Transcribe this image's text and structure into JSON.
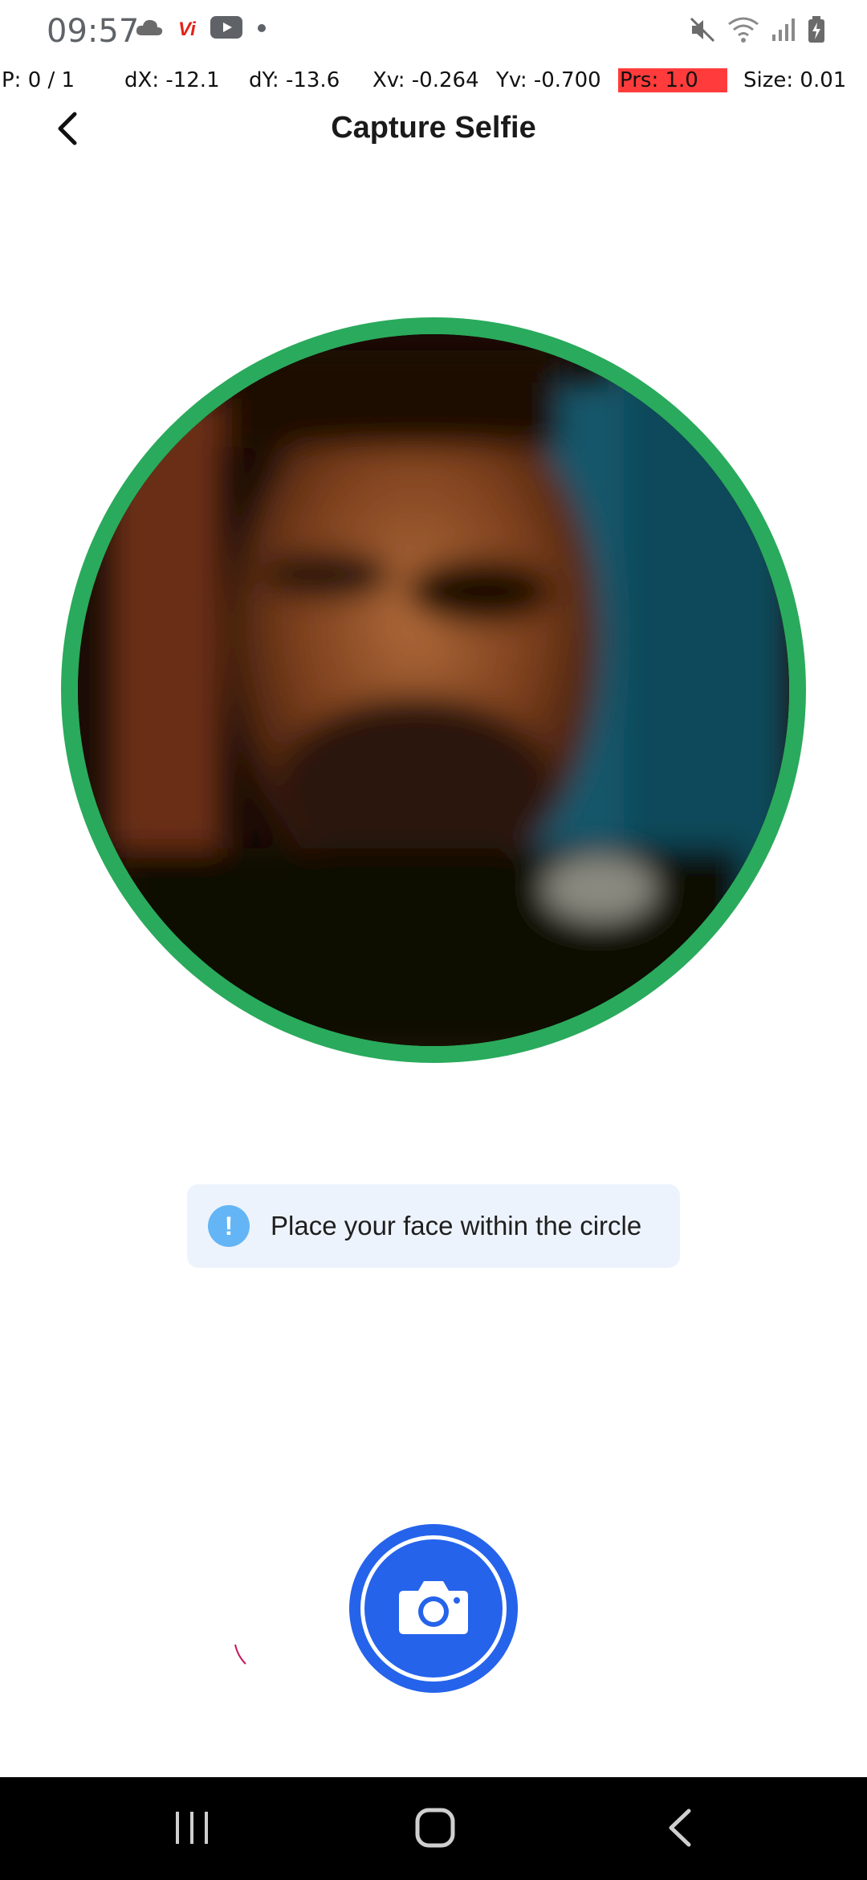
{
  "status_bar": {
    "time": "09:57",
    "left_icons": [
      "cloud-icon",
      "vi-carrier-icon",
      "youtube-icon",
      "dot-icon"
    ],
    "right_icons": [
      "mute-icon",
      "wifi-icon",
      "signal-icon",
      "battery-charging-icon"
    ],
    "carrier_badge": "Vi"
  },
  "debug": {
    "pointer": "P: 0 / 1",
    "dx": "dX: -12.1",
    "dy": "dY: -13.6",
    "xv": "Xv: -0.264",
    "yv": "Yv: -0.700",
    "prs": "Prs: 1.0",
    "size": "Size: 0.01"
  },
  "header": {
    "title": "Capture Selfie",
    "back_icon": "chevron-left-icon"
  },
  "camera": {
    "ring_color": "#2aaa5c"
  },
  "hint": {
    "icon": "info-exclamation-icon",
    "text": "Place your face within the circle"
  },
  "capture_button": {
    "icon": "camera-icon",
    "color": "#2563eb"
  },
  "nav_bar": {
    "items": [
      "recent-apps-icon",
      "home-icon",
      "back-icon"
    ]
  }
}
